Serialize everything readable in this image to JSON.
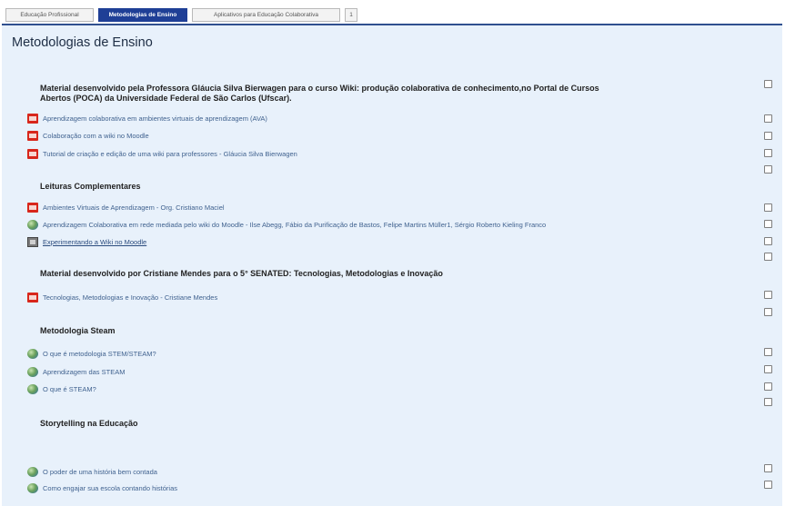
{
  "tabs": [
    {
      "label": "Educação Profissional",
      "active": false
    },
    {
      "label": "Metodologias de Ensino",
      "active": true
    },
    {
      "label": "Aplicativos para Educação Colaborativa",
      "active": false
    },
    {
      "label": "1",
      "active": false
    }
  ],
  "page": {
    "title": "Metodologias de Ensino"
  },
  "sections": {
    "s1": {
      "line1": "Material desenvolvido pela Professora Gláucia Silva Bierwagen para o curso Wiki: produção colaborativa de conhecimento,no Portal de Cursos",
      "line2": "Abertos (POCA) da Universidade Federal de São Carlos (Ufscar)."
    },
    "s2": "Leituras Complementares",
    "s3": "Material desenvolvido por Cristiane Mendes para o 5° SENATED: Tecnologias, Metodologias e Inovação",
    "s4": "Metodologia Steam",
    "s5": "Storytelling na Educação"
  },
  "items": [
    {
      "label": "Aprendizagem colaborativa em ambientes virtuais de aprendizagem (AVA)",
      "icon": "pdf-icon"
    },
    {
      "label": "Colaboração com a wiki no Moodle",
      "icon": "pdf-icon"
    },
    {
      "label": "Tutorial de criação e edição de uma wiki para professores - Gláucia Silva Bierwagen",
      "icon": "pdf-icon"
    },
    {
      "label": "Ambientes Virtuais de Aprendizagem - Org. Cristiano Maciel",
      "icon": "pdf-icon"
    },
    {
      "label": "Aprendizagem Colaborativa em rede mediada pelo wiki do Moodle - Ilse Abegg, Fábio da Purificação de Bastos, Felipe Martins Müller1, Sérgio Roberto Kieling Franco",
      "icon": "globe-icon"
    },
    {
      "label": "Experimentando a Wiki no Moodle",
      "icon": "image-icon"
    },
    {
      "label": "Tecnologias, Metodologias e Inovação - Cristiane Mendes",
      "icon": "pdf-icon"
    },
    {
      "label": "O que é metodologia STEM/STEAM?",
      "icon": "globe-icon"
    },
    {
      "label": "Aprendizagem das STEAM",
      "icon": "globe-icon"
    },
    {
      "label": "O que é STEAM?",
      "icon": "globe-icon"
    },
    {
      "label": "O poder de uma história bem contada",
      "icon": "globe-icon"
    },
    {
      "label": "Como engajar sua escola contando histórias",
      "icon": "globe-icon"
    }
  ],
  "colors": {
    "tab_active": "#1f3f96",
    "content_bg": "#e8f1fb",
    "link": "#40628f",
    "pdf": "#d8261b"
  }
}
